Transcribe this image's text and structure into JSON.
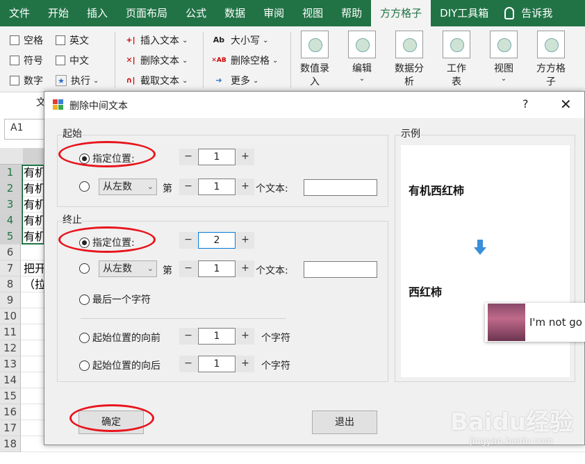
{
  "menu": {
    "tabs": [
      "文件",
      "开始",
      "插入",
      "页面布局",
      "公式",
      "数据",
      "审阅",
      "视图",
      "帮助",
      "方方格子",
      "DIY工具箱"
    ],
    "active_tab": "方方格子",
    "tell_me": "告诉我"
  },
  "ribbon": {
    "checkboxes": [
      "空格",
      "英文",
      "符号",
      "中文",
      "数字"
    ],
    "execute": "执行",
    "text_tools": [
      "插入文本",
      "删除文本",
      "截取文本"
    ],
    "case_tools": [
      "大小写",
      "删除空格",
      "更多"
    ],
    "group_label_partial": "文",
    "big_buttons": [
      {
        "line1": "数值录",
        "line2": "入"
      },
      {
        "line1": "编辑",
        "line2": ""
      },
      {
        "line1": "数据分",
        "line2": "析"
      },
      {
        "line1": "工作",
        "line2": "表"
      },
      {
        "line1": "视图",
        "line2": ""
      },
      {
        "line1": "方方格",
        "line2": "子"
      }
    ]
  },
  "namebox": "A1",
  "sheet": {
    "rows": [
      "1",
      "2",
      "3",
      "4",
      "5",
      "6",
      "7",
      "8",
      "9",
      "10",
      "11",
      "12",
      "13",
      "14",
      "15",
      "16",
      "17",
      "18"
    ],
    "cells": [
      "有机",
      "有机",
      "有机",
      "有机",
      "有机",
      "",
      "把开",
      "（拉"
    ]
  },
  "dialog": {
    "title": "删除中间文本",
    "help": "?",
    "close": "✕",
    "start": {
      "label": "起始",
      "option_position": "指定位置:",
      "position_value": "1",
      "left_combo": "从左数",
      "di": "第",
      "nth_value": "1",
      "nth_suffix": "个文本:"
    },
    "end": {
      "label": "终止",
      "option_position": "指定位置:",
      "position_value": "2",
      "left_combo": "从左数",
      "di": "第",
      "nth_value": "1",
      "nth_suffix": "个文本:",
      "option_last": "最后一个字符",
      "option_before": "起始位置的向前",
      "before_value": "1",
      "option_after": "起始位置的向后",
      "after_value": "1",
      "char_suffix": "个字符"
    },
    "example": {
      "label": "示例",
      "before_text": "有机西红柿",
      "after_text": "西红柿"
    },
    "ok": "确定",
    "exit": "退出"
  },
  "popup": {
    "text": "I'm not go"
  },
  "watermark": {
    "brand": "Baidu经验",
    "url": "jingyan.baidu.com"
  },
  "colors": {
    "excel_green": "#217346",
    "annotation_red": "#e8141c",
    "arrow_blue": "#3a8fd8"
  }
}
